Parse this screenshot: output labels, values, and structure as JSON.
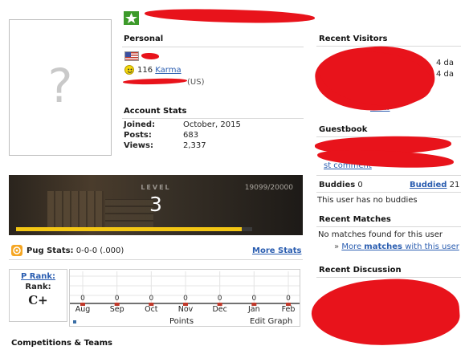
{
  "profile": {
    "avatar_glyph": "?",
    "personal_header": "Personal",
    "karma_value": "116",
    "karma_label": "Karma",
    "location_suffix": "(US)",
    "flag": "us-flag-icon",
    "status_icon": "online-status-icon"
  },
  "account_stats": {
    "header": "Account Stats",
    "rows": [
      {
        "label": "Joined:",
        "value": "October, 2015"
      },
      {
        "label": "Posts:",
        "value": "683"
      },
      {
        "label": "Views:",
        "value": "2,337"
      }
    ]
  },
  "level_banner": {
    "level_label": "LEVEL",
    "level_value": "3",
    "xp_text": "19099/20000",
    "xp_progress": 0.955
  },
  "pug_stats": {
    "label": "Pug Stats:",
    "value": "0-0-0 (.000)",
    "more_link": "More Stats"
  },
  "rank": {
    "p_rank_link": "P Rank:",
    "rank_label": "Rank:",
    "rank_value": "C+"
  },
  "points_chart": {
    "months": [
      "Aug",
      "Sep",
      "Oct",
      "Nov",
      "Dec",
      "Jan",
      "Feb"
    ],
    "values": [
      0,
      0,
      0,
      0,
      0,
      0,
      0
    ],
    "point_label": "0",
    "x_title": "Points",
    "edit_label": "Edit Graph"
  },
  "competitions_header": "Competitions & Teams",
  "recent_visitors": {
    "header": "Recent Visitors",
    "times": [
      "4 da",
      "4 da"
    ],
    "tail": "www"
  },
  "guestbook": {
    "header": "Guestbook",
    "link_tail": "st comment"
  },
  "buddies": {
    "label": "Buddies",
    "count": "0",
    "buddied_label": "Buddied",
    "buddied_count": "21",
    "empty_text": "This user has no buddies"
  },
  "recent_matches": {
    "header": "Recent Matches",
    "empty_text": "No matches found for this user",
    "more_prefix": "»",
    "more_link_a": "More ",
    "more_link_b": "matches",
    "more_link_c": " with this user"
  },
  "recent_discussion": {
    "header": "Recent Discussion"
  },
  "colors": {
    "link": "#2a5db0",
    "redaction": "#e8131b",
    "xp_bar": "#f3c614",
    "status_green": "#3c9a2a"
  }
}
